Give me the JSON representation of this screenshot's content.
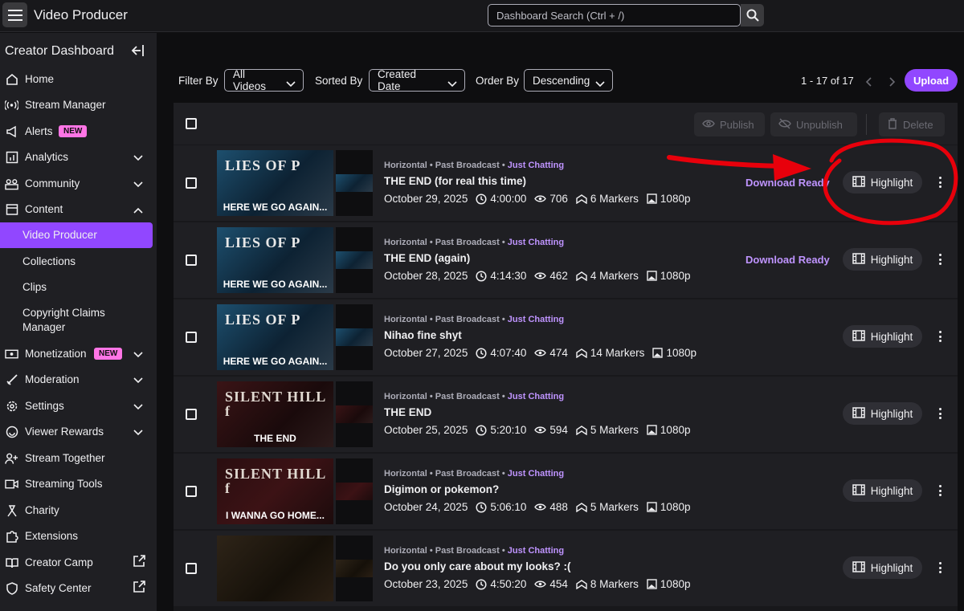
{
  "topbar": {
    "menu_icon": "hamburger-icon",
    "title": "Video Producer",
    "search_placeholder": "Dashboard Search (Ctrl + /)",
    "search_icon": "search-icon"
  },
  "sidebar": {
    "header": "Creator Dashboard",
    "items": [
      {
        "label": "Home",
        "icon": "home-icon"
      },
      {
        "label": "Stream Manager",
        "icon": "broadcast-icon"
      },
      {
        "label": "Alerts",
        "icon": "megaphone-icon",
        "badge": "NEW"
      },
      {
        "label": "Analytics",
        "icon": "analytics-icon"
      },
      {
        "label": "Community",
        "icon": "community-icon"
      },
      {
        "label": "Content",
        "icon": "content-icon"
      },
      {
        "label": "Monetization",
        "icon": "monetization-icon",
        "badge": "NEW"
      },
      {
        "label": "Moderation",
        "icon": "sword-icon"
      },
      {
        "label": "Settings",
        "icon": "gear-icon"
      },
      {
        "label": "Viewer Rewards",
        "icon": "rewards-icon"
      },
      {
        "label": "Stream Together",
        "icon": "add-user-icon"
      },
      {
        "label": "Streaming Tools",
        "icon": "camera-icon"
      },
      {
        "label": "Charity",
        "icon": "ribbon-icon"
      },
      {
        "label": "Extensions",
        "icon": "puzzle-icon"
      },
      {
        "label": "Creator Camp",
        "icon": "book-icon"
      },
      {
        "label": "Safety Center",
        "icon": "shield-icon"
      }
    ],
    "content_sub": [
      "Video Producer",
      "Collections",
      "Clips",
      "Copyright Claims",
      "Manager"
    ]
  },
  "filters": {
    "filter_by_label": "Filter By",
    "filter_by_value": "All Videos",
    "sorted_by_label": "Sorted By",
    "sorted_by_value": "Created Date",
    "order_by_label": "Order By",
    "order_by_value": "Descending",
    "pagination": "1 - 17 of 17",
    "upload_label": "Upload"
  },
  "toolbar": {
    "publish": "Publish",
    "unpublish": "Unpublish",
    "delete": "Delete"
  },
  "videos": [
    {
      "meta": "Horizontal • Past Broadcast • ",
      "category": "Just Chatting",
      "title": "THE END (for real this time)",
      "date": "October 29, 2025",
      "duration": "4:00:00",
      "views": "706",
      "markers": "6 Markers",
      "quality": "1080p",
      "download": "Download Ready",
      "action": "Highlight",
      "thumb_text": "HERE WE GO AGAIN...",
      "thumb_logo": "LIES OF P"
    },
    {
      "meta": "Horizontal • Past Broadcast • ",
      "category": "Just Chatting",
      "title": "THE END (again)",
      "date": "October 28, 2025",
      "duration": "4:14:30",
      "views": "462",
      "markers": "4 Markers",
      "quality": "1080p",
      "download": "Download Ready",
      "action": "Highlight",
      "thumb_text": "HERE WE GO AGAIN...",
      "thumb_logo": "LIES OF P"
    },
    {
      "meta": "Horizontal • Past Broadcast • ",
      "category": "Just Chatting",
      "title": "Nihao fine shyt",
      "date": "October 27, 2025",
      "duration": "4:07:40",
      "views": "474",
      "markers": "14 Markers",
      "quality": "1080p",
      "download": "",
      "action": "Highlight",
      "thumb_text": "HERE WE GO AGAIN...",
      "thumb_logo": "LIES OF P"
    },
    {
      "meta": "Horizontal • Past Broadcast • ",
      "category": "Just Chatting",
      "title": "THE END",
      "date": "October 25, 2025",
      "duration": "5:20:10",
      "views": "594",
      "markers": "5 Markers",
      "quality": "1080p",
      "download": "",
      "action": "Highlight",
      "thumb_text": "THE END",
      "thumb_logo": "SILENT HILL f"
    },
    {
      "meta": "Horizontal • Past Broadcast • ",
      "category": "Just Chatting",
      "title": "Digimon or pokemon?",
      "date": "October 24, 2025",
      "duration": "5:06:10",
      "views": "488",
      "markers": "5 Markers",
      "quality": "1080p",
      "download": "",
      "action": "Highlight",
      "thumb_text": "I WANNA GO HOME...",
      "thumb_logo": "SILENT HILL f"
    },
    {
      "meta": "Horizontal • Past Broadcast • ",
      "category": "Just Chatting",
      "title": "Do you only care about my looks? :(",
      "date": "October 23, 2025",
      "duration": "4:50:20",
      "views": "454",
      "markers": "8 Markers",
      "quality": "1080p",
      "download": "",
      "action": "Highlight",
      "thumb_text": "",
      "thumb_logo": ""
    }
  ],
  "colors": {
    "accent": "#9147ff",
    "accent_text": "#bf94ff",
    "annotation": "#e8000b",
    "badge_pink": "#ff75e6"
  }
}
